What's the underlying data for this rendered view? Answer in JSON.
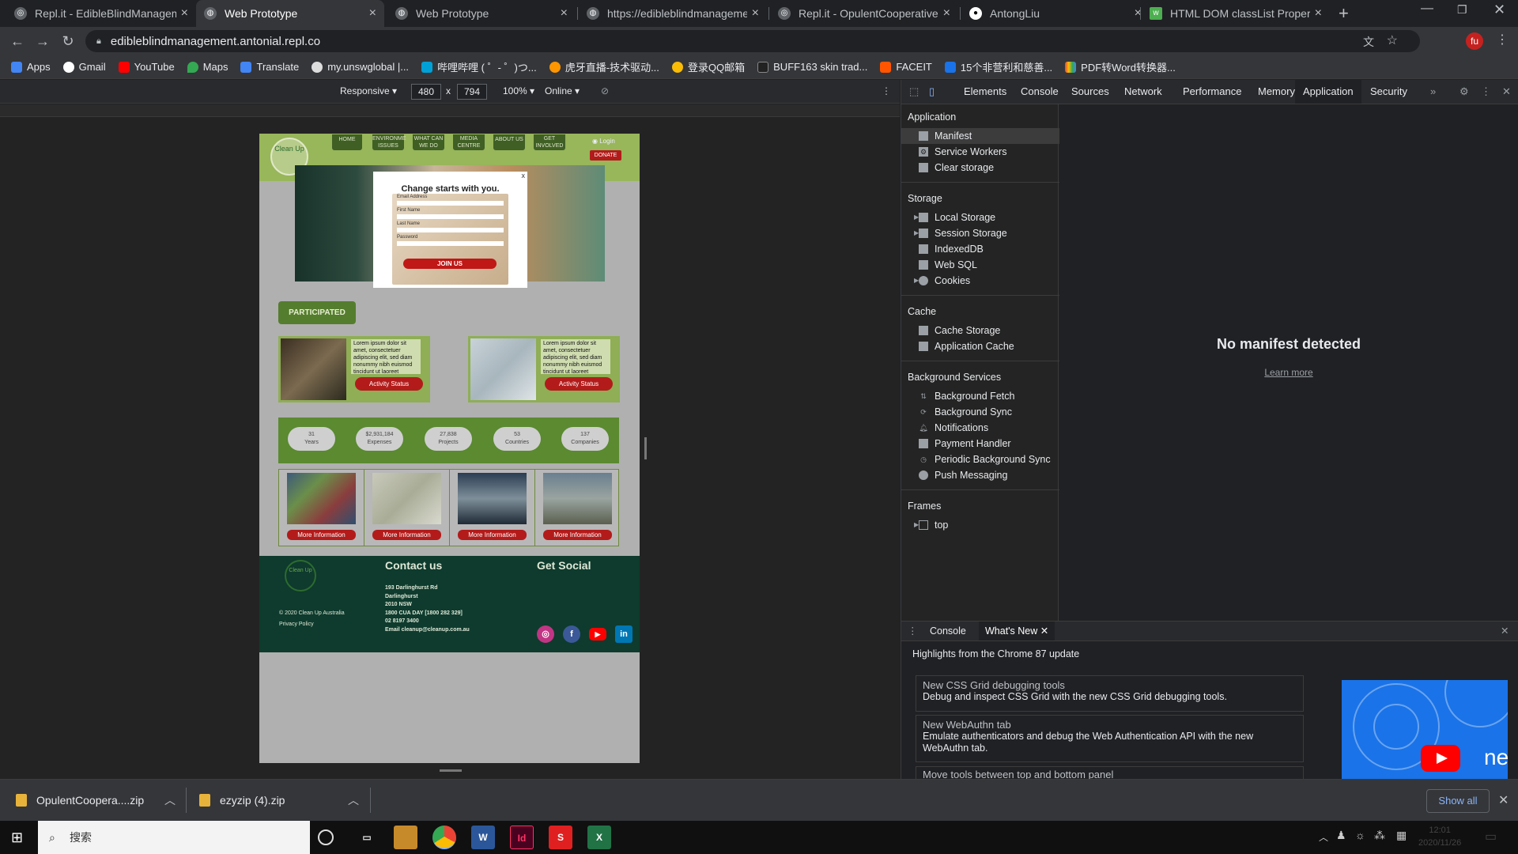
{
  "browser": {
    "tabs": [
      {
        "title": "Repl.it - EdibleBlindManageme",
        "active": false
      },
      {
        "title": "Web Prototype",
        "active": true
      },
      {
        "title": "Web Prototype",
        "active": false
      },
      {
        "title": "https://edibleblindmanageme",
        "active": false
      },
      {
        "title": "Repl.it - OpulentCooperativeM",
        "active": false
      },
      {
        "title": "AntongLiu",
        "active": false
      },
      {
        "title": "HTML DOM classList Property",
        "active": false
      }
    ],
    "new_tab": "+",
    "url": "edibleblindmanagement.antonial.repl.co",
    "profile_initials": "fu",
    "bookmarks": [
      "Apps",
      "Gmail",
      "YouTube",
      "Maps",
      "Translate",
      "my.unswglobal |...",
      "哔哩哔哩 ( ゜- ゜)つ...",
      "虎牙直播-技术驱动...",
      "登录QQ邮箱",
      "BUFF163 skin trad...",
      "FACEIT",
      "15个非营利和慈善...",
      "PDF转Word转换器..."
    ]
  },
  "device_toolbar": {
    "mode": "Responsive",
    "width": "480",
    "times": "x",
    "height": "794",
    "zoom": "100%",
    "network": "Online"
  },
  "site": {
    "logo_text": "Clean Up",
    "nav": [
      "HOME",
      "ENVIRONME ISSUES",
      "WHAT CAN WE DO",
      "MEDIA CENTRE",
      "ABOUT US",
      "GET INVOLVED"
    ],
    "login": "Login",
    "donate": "DONATE",
    "modal": {
      "close": "x",
      "title": "Change starts with you.",
      "fields": [
        "Email Address",
        "First Name",
        "Last Name",
        "Password"
      ],
      "submit": "JOIN US"
    },
    "participated": "PARTICIPATED",
    "cards": [
      {
        "text": "Lorem ipsum dolor sit amet, consectetuer adipiscing elit, sed diam nonummy nibh euismod tincidunt ut laoreet",
        "button": "Activity Status"
      },
      {
        "text": "Lorem ipsum dolor sit amet, consectetuer adipiscing elit, sed diam nonummy nibh euismod tincidunt ut laoreet",
        "button": "Activity Status"
      }
    ],
    "stats": [
      {
        "value": "31",
        "label": "Years"
      },
      {
        "value": "$2,931,184",
        "label": "Expenses"
      },
      {
        "value": "27,838",
        "label": "Projects"
      },
      {
        "value": "53",
        "label": "Countries"
      },
      {
        "value": "137",
        "label": "Companies"
      }
    ],
    "more_buttons": [
      "More Information",
      "More Information",
      "More Information",
      "More Information"
    ],
    "footer": {
      "contact_title": "Contact us",
      "social_title": "Get Social",
      "address": [
        "193 Darlinghurst Rd",
        "Darlinghurst",
        "2010 NSW",
        "1800 CUA DAY [1800 282 329]",
        "02 8197 3400",
        "Email cleanup@cleanup.com.au"
      ],
      "copyright": "© 2020 Clean Up Australia",
      "privacy": "Privacy Policy",
      "social_icons": [
        "instagram-icon",
        "facebook-icon",
        "youtube-icon",
        "linkedin-icon"
      ]
    }
  },
  "devtools": {
    "tabs": [
      "Elements",
      "Console",
      "Sources",
      "Network",
      "Performance",
      "Memory",
      "Application",
      "Security"
    ],
    "active_tab": "Application",
    "more": "»",
    "sidebar": {
      "application": {
        "title": "Application",
        "items": [
          "Manifest",
          "Service Workers",
          "Clear storage"
        ]
      },
      "storage": {
        "title": "Storage",
        "items": [
          "Local Storage",
          "Session Storage",
          "IndexedDB",
          "Web SQL",
          "Cookies"
        ]
      },
      "cache": {
        "title": "Cache",
        "items": [
          "Cache Storage",
          "Application Cache"
        ]
      },
      "background": {
        "title": "Background Services",
        "items": [
          "Background Fetch",
          "Background Sync",
          "Notifications",
          "Payment Handler",
          "Periodic Background Sync",
          "Push Messaging"
        ]
      },
      "frames": {
        "title": "Frames",
        "items": [
          "top"
        ]
      }
    },
    "main_message": "No manifest detected",
    "learn_more": "Learn more",
    "drawer": {
      "tabs": [
        "Console",
        "What's New"
      ],
      "heading": "Highlights from the Chrome 87 update",
      "items": [
        {
          "title": "New CSS Grid debugging tools",
          "desc": "Debug and inspect CSS Grid with the new CSS Grid debugging tools."
        },
        {
          "title": "New WebAuthn tab",
          "desc": "Emulate authenticators and debug the Web Authentication API with the new WebAuthn tab."
        },
        {
          "title": "Move tools between top and bottom panel",
          "desc": ""
        }
      ],
      "promo_text": "ne"
    }
  },
  "downloads": {
    "items": [
      "OpulentCoopera....zip",
      "ezyzip (4).zip"
    ],
    "show_all": "Show all"
  },
  "taskbar": {
    "search_placeholder": "搜索",
    "time": "12:01",
    "date": "2020/11/26"
  }
}
